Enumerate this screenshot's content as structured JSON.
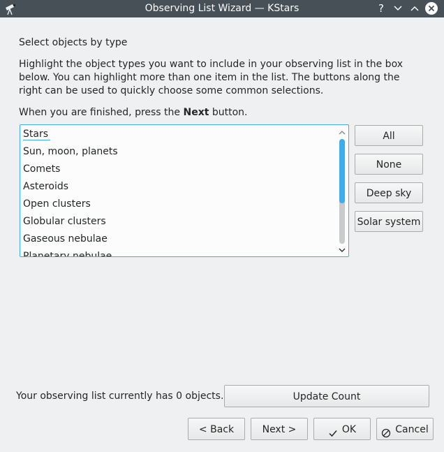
{
  "window": {
    "title": "Observing List Wizard — KStars",
    "help_glyph": "?",
    "icons": [
      "telescope-icon",
      "help-icon",
      "minimize-icon",
      "maximize-icon",
      "close-icon"
    ]
  },
  "page": {
    "heading": "Select objects by type",
    "intro": "Highlight the object types you want to include in your observing list in the box below. You can highlight more than one item in the list. The buttons along the right can be used to quickly choose some common selections.",
    "finish_prefix": "When you are finished, press the",
    "finish_bold": "Next",
    "finish_suffix": "button."
  },
  "object_types": {
    "items": [
      "Stars",
      "Sun, moon, planets",
      "Comets",
      "Asteroids",
      "Open clusters",
      "Globular clusters",
      "Gaseous nebulae",
      "Planetary nebulae"
    ],
    "focused_index": 0
  },
  "quick_buttons": {
    "all": "All",
    "none": "None",
    "deep_sky": "Deep sky",
    "solar_system": "Solar system"
  },
  "count": {
    "text": "Your observing list currently has 0 objects.",
    "update_label": "Update Count"
  },
  "nav": {
    "back": "< Back",
    "next": "Next >",
    "ok": "OK",
    "cancel": "Cancel"
  },
  "colors": {
    "titlebar": "#475057",
    "accent": "#3daee9",
    "window_bg": "#eff0f1"
  }
}
